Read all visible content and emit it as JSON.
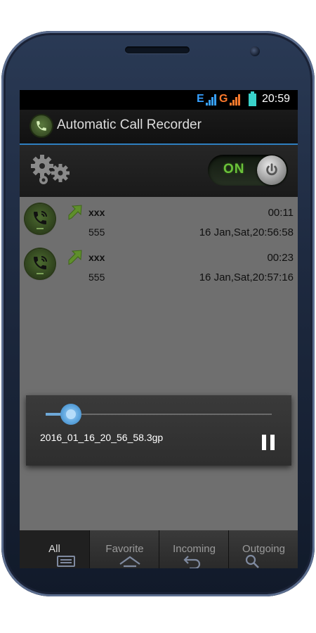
{
  "status_bar": {
    "network_e": "E",
    "network_g": "G",
    "time": "20:59"
  },
  "app_bar": {
    "title": "Automatic Call Recorder"
  },
  "toolbar": {
    "toggle_label": "ON"
  },
  "recordings": [
    {
      "name": "xxx",
      "number": "555",
      "duration": "00:11",
      "datetime": "16 Jan,Sat,20:56:58",
      "direction": "outgoing"
    },
    {
      "name": "xxx",
      "number": "555",
      "duration": "00:23",
      "datetime": "16 Jan,Sat,20:57:16",
      "direction": "outgoing"
    }
  ],
  "player": {
    "filename": "2016_01_16_20_56_58.3gp",
    "progress": 0.11,
    "state": "playing"
  },
  "tabs": [
    {
      "label": "All",
      "active": true
    },
    {
      "label": "Favorite",
      "active": false
    },
    {
      "label": "Incoming",
      "active": false
    },
    {
      "label": "Outgoing",
      "active": false
    }
  ],
  "colors": {
    "accent": "#2e7fc0",
    "toggle_on": "#6bc23a",
    "content_bg": "#6f6f6f",
    "arrow": "#5f8f2c"
  },
  "icons": [
    "app-phone-icon",
    "settings-gears-icon",
    "power-icon",
    "call-avatar-icon",
    "outgoing-arrow-icon",
    "pause-icon",
    "menu-icon",
    "home-icon",
    "back-icon",
    "search-icon"
  ]
}
